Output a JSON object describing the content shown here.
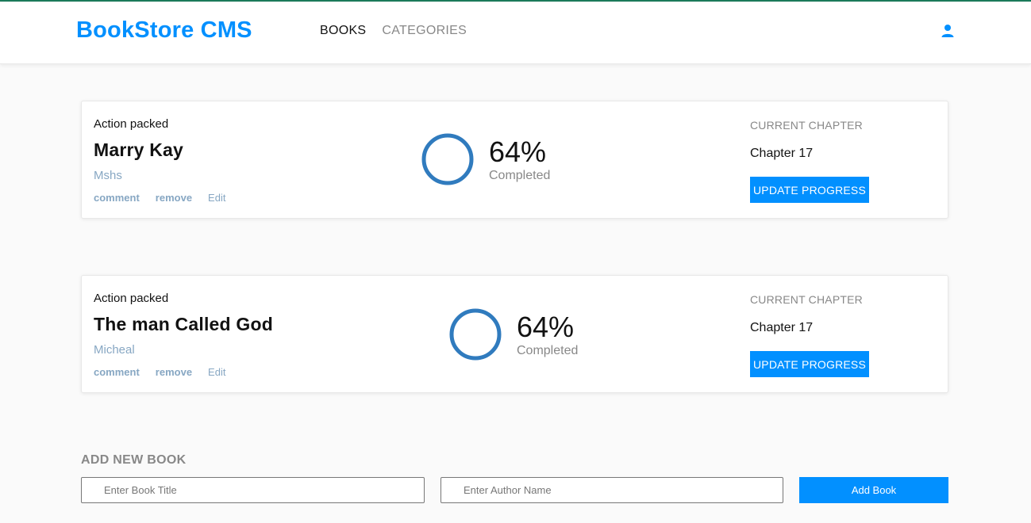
{
  "header": {
    "logo": "BookStore CMS",
    "nav": [
      {
        "label": "BOOKS"
      },
      {
        "label": "CATEGORIES"
      }
    ],
    "user_icon": "user-icon"
  },
  "books": [
    {
      "genre": "Action packed",
      "title": "Marry Kay",
      "author": "Mshs",
      "actions": {
        "comment": "comment",
        "remove": "remove",
        "edit": "Edit"
      },
      "progress_percent": "64%",
      "progress_label": "Completed",
      "chapter_heading": "CURRENT CHAPTER",
      "chapter": "Chapter 17",
      "update_label": "UPDATE PROGRESS"
    },
    {
      "genre": "Action packed",
      "title": "The man Called God",
      "author": "Micheal",
      "actions": {
        "comment": "comment",
        "remove": "remove",
        "edit": "Edit"
      },
      "progress_percent": "64%",
      "progress_label": "Completed",
      "chapter_heading": "CURRENT CHAPTER",
      "chapter": "Chapter 17",
      "update_label": "UPDATE PROGRESS"
    }
  ],
  "form": {
    "title": "ADD NEW BOOK",
    "title_placeholder": "Enter Book Title",
    "author_placeholder": "Enter Author Name",
    "submit_label": "Add Book"
  },
  "colors": {
    "brand": "#0290ff",
    "ring": "#307bbe",
    "muted_text": "#888888",
    "link_text": "#87a7c3",
    "top_accent": "#1b7a5a"
  }
}
